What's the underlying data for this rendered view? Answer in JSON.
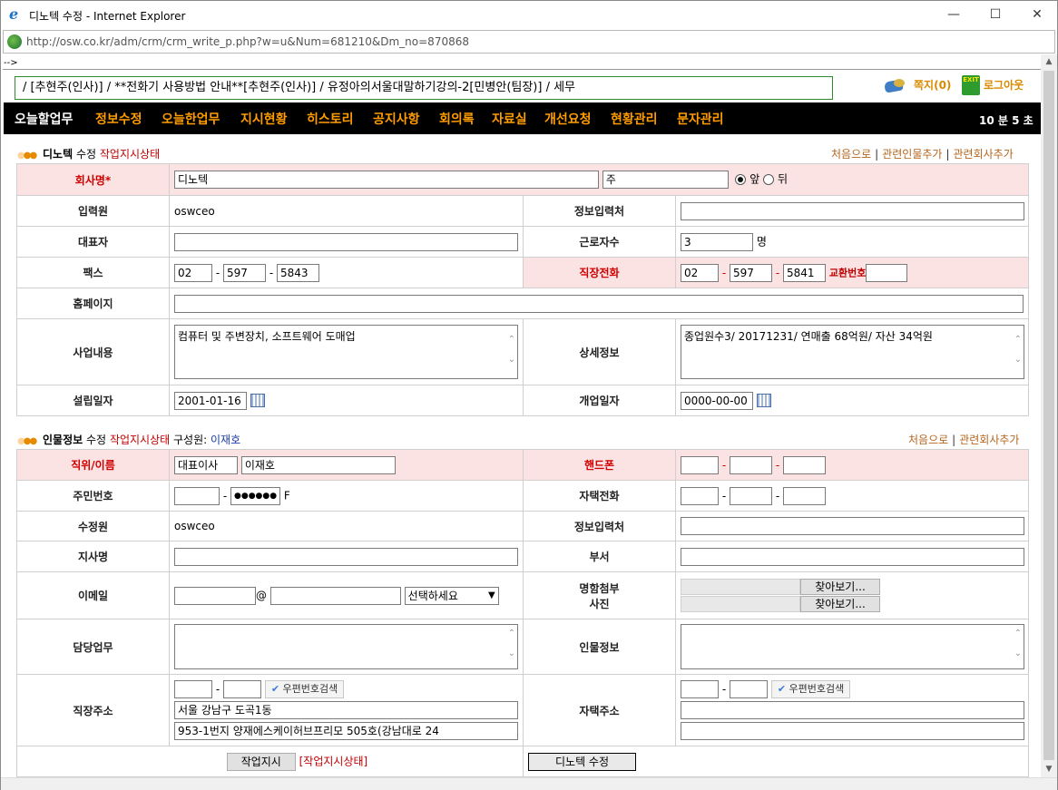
{
  "window": {
    "title": "디노텍 수정 - Internet Explorer",
    "address": "http://osw.co.kr/adm/crm/crm_write_p.php?w=u&Num=681210&Dm_no=870868",
    "stray_text": "-->"
  },
  "ticker": {
    "text": "/    [추현주(인사)]     /    **전화기 사용방법 안내**[추현주(인사)]     /    유정아의서울대말하기강의-2[민병안(팀장)]     /    세무"
  },
  "header_links": {
    "memo": "쪽지(0)",
    "exit_icon_text": "EXIT",
    "logout": "로그아웃"
  },
  "nav": {
    "items": [
      "오늘할업무",
      "정보수정",
      "오늘한업무",
      "지시현황",
      "히스토리",
      "공지사항",
      "회의록",
      "자료실",
      "개선요청",
      "현황관리",
      "문자관리"
    ],
    "timer": "10 분 5 초"
  },
  "company_section": {
    "name": "디노텍",
    "edit": "수정",
    "status": "작업지시상태",
    "links": [
      "처음으로",
      "관련인물추가",
      "관련회사추가"
    ],
    "fields": {
      "company_label": "회사명*",
      "company_value": "디노텍",
      "company_suffix": "주",
      "radio_front": "앞",
      "radio_back": "뒤",
      "inputter_label": "입력원",
      "inputter_value": "oswceo",
      "info_source_label": "정보입력처",
      "ceo_label": "대표자",
      "employees_label": "근로자수",
      "employees_value": "3",
      "employees_unit": "명",
      "fax_label": "팩스",
      "fax": [
        "02",
        "597",
        "5843"
      ],
      "work_phone_label": "직장전화",
      "work_phone": [
        "02",
        "597",
        "5841"
      ],
      "exchange_label": "교환번호",
      "homepage_label": "홈페이지",
      "business_label": "사업내용",
      "business_value": "컴퓨터 및 주변장치, 소프트웨어 도매업",
      "detail_label": "상세정보",
      "detail_value": "종업원수3/ 20171231/ 연매출 68억원/ 자산 34억원",
      "founded_label": "설립일자",
      "founded_value": "2001-01-16",
      "opened_label": "개업일자",
      "opened_value": "0000-00-00"
    }
  },
  "person_section": {
    "title": "인물정보",
    "edit": "수정",
    "status": "작업지시상태",
    "member_label": "구성원:",
    "member_name": "이재호",
    "links": [
      "처음으로",
      "관련회사추가"
    ],
    "fields": {
      "position_label": "직위/이름",
      "position_value": "대표이사",
      "name_value": "이재호",
      "mobile_label": "핸드폰",
      "ssn_label": "주민번호",
      "ssn_masked": "●●●●●●",
      "ssn_gender": "F",
      "home_phone_label": "자택전화",
      "editor_label": "수정원",
      "editor_value": "oswceo",
      "info_source_label": "정보입력처",
      "branch_label": "지사명",
      "dept_label": "부서",
      "email_label": "이메일",
      "email_at": "@",
      "email_select": "선택하세요",
      "card_label_1": "명함첨부",
      "card_label_2": "사진",
      "browse": "찾아보기...",
      "duty_label": "담당업무",
      "person_info_label": "인물정보",
      "work_addr_label": "직장주소",
      "zip_search": "우편번호검색",
      "work_addr_1": "서울 강남구 도곡1동",
      "work_addr_2": "953-1번지 양재에스케이허브프리모 505호(강남대로 24",
      "home_addr_label": "자택주소"
    },
    "buttons": {
      "assign": "작업지시",
      "assign_status": "[작업지시상태]",
      "submit": "디노텍 수정"
    }
  }
}
